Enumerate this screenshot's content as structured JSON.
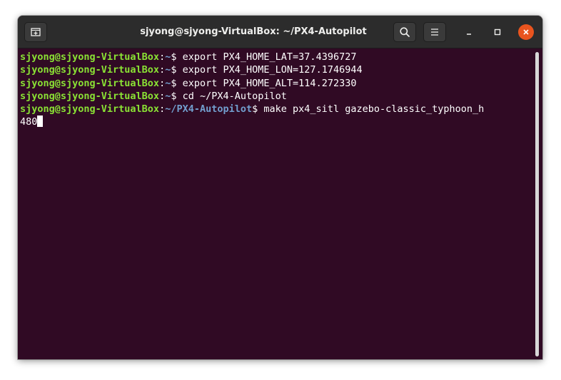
{
  "window": {
    "title": "sjyong@sjyong-VirtualBox: ~/PX4-Autopilot"
  },
  "terminal": {
    "lines": [
      {
        "user": "sjyong@sjyong-VirtualBox",
        "sep": ":",
        "path": "~",
        "prompt": "$",
        "command": " export PX4_HOME_LAT=37.4396727"
      },
      {
        "user": "sjyong@sjyong-VirtualBox",
        "sep": ":",
        "path": "~",
        "prompt": "$",
        "command": " export PX4_HOME_LON=127.1746944"
      },
      {
        "user": "sjyong@sjyong-VirtualBox",
        "sep": ":",
        "path": "~",
        "prompt": "$",
        "command": " export PX4_HOME_ALT=114.272330"
      },
      {
        "user": "sjyong@sjyong-VirtualBox",
        "sep": ":",
        "path": "~",
        "prompt": "$",
        "command": " cd ~/PX4-Autopilot"
      },
      {
        "user": "sjyong@sjyong-VirtualBox",
        "sep": ":",
        "path": "~/PX4-Autopilot",
        "prompt": "$",
        "command": " make px4_sitl gazebo-classic_typhoon_h"
      }
    ],
    "continuation": "480"
  },
  "icons": {
    "new_tab": "new-tab-icon",
    "search": "search-icon",
    "menu": "hamburger-menu-icon",
    "minimize": "minimize-icon",
    "maximize": "maximize-icon",
    "close": "close-icon"
  },
  "colors": {
    "terminal_background": "#300a24",
    "user_host": "#8ae234",
    "path": "#729fcf",
    "text": "#ffffff",
    "titlebar": "#2c2c2c",
    "close_button": "#e9541e"
  }
}
